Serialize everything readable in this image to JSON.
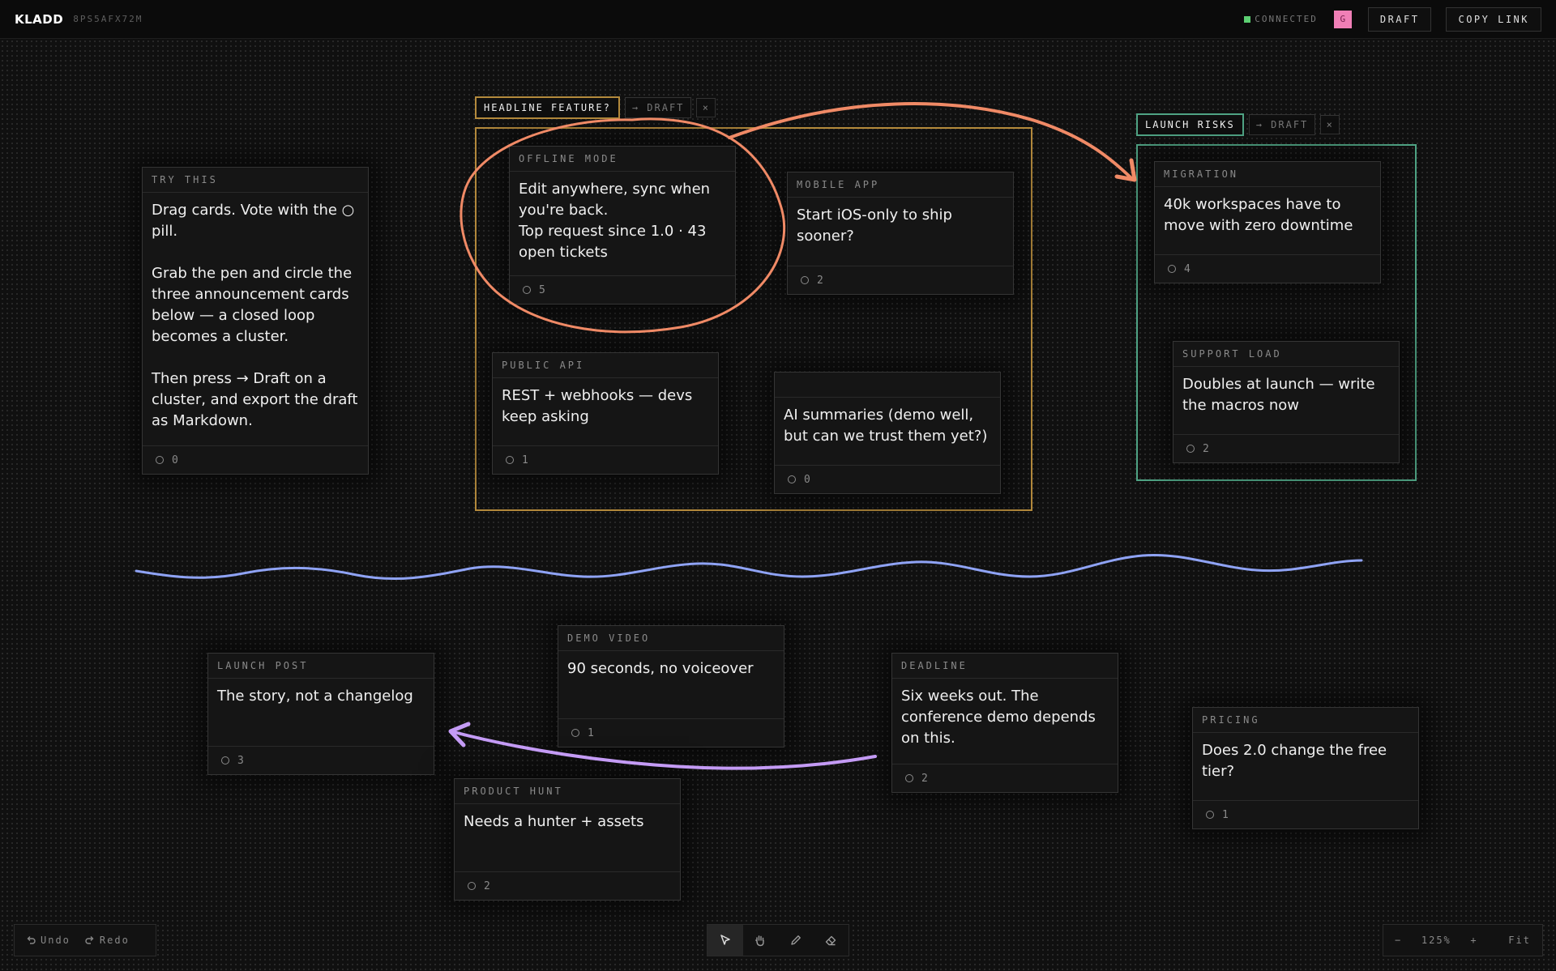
{
  "app": {
    "name": "KLADD",
    "board_id": "8PS5AFX72M"
  },
  "topbar": {
    "status": "CONNECTED",
    "avatar": "G",
    "draft_label": "DRAFT",
    "copy_link_label": "COPY LINK"
  },
  "clusters": [
    {
      "label": "HEADLINE FEATURE?",
      "draft_label": "→ DRAFT",
      "close_label": "×",
      "color": "#b48a3c"
    },
    {
      "label": "LAUNCH RISKS",
      "draft_label": "→ DRAFT",
      "close_label": "×",
      "color": "#4fa384"
    }
  ],
  "cards": {
    "try_this": {
      "title": "TRY THIS",
      "body": "Drag cards. Vote with the ○ pill.\n\nGrab the pen and circle the three announcement cards below — a closed loop becomes a cluster.\n\nThen press → Draft on a cluster, and export the draft as Markdown.",
      "votes": "0"
    },
    "offline_mode": {
      "title": "OFFLINE MODE",
      "body": "Edit anywhere, sync when you're back.\nTop request since 1.0 · 43 open tickets",
      "votes": "5"
    },
    "mobile_app": {
      "title": "MOBILE APP",
      "body": "Start iOS-only to ship sooner?",
      "votes": "2"
    },
    "public_api": {
      "title": "PUBLIC API",
      "body": "REST + webhooks — devs keep asking",
      "votes": "1"
    },
    "ai_summaries": {
      "title": "",
      "body": "AI summaries (demo well, but can we trust them yet?)",
      "votes": "0"
    },
    "migration": {
      "title": "MIGRATION",
      "body": "40k workspaces have to move with zero downtime",
      "votes": "4"
    },
    "support_load": {
      "title": "SUPPORT LOAD",
      "body": "Doubles at launch — write the macros now",
      "votes": "2"
    },
    "launch_post": {
      "title": "LAUNCH POST",
      "body": "The story, not a changelog",
      "votes": "3"
    },
    "demo_video": {
      "title": "DEMO VIDEO",
      "body": "90 seconds, no voiceover",
      "votes": "1"
    },
    "deadline": {
      "title": "DEADLINE",
      "body": "Six weeks out. The conference demo depends on this.",
      "votes": "2"
    },
    "product_hunt": {
      "title": "PRODUCT HUNT",
      "body": "Needs a hunter + assets",
      "votes": "2"
    },
    "pricing": {
      "title": "PRICING",
      "body": "Does 2.0 change the free tier?",
      "votes": "1"
    }
  },
  "history": {
    "undo": "Undo",
    "redo": "Redo"
  },
  "tools": [
    {
      "name": "select",
      "icon": "cursor-arrow-icon",
      "active": true
    },
    {
      "name": "hand",
      "icon": "hand-icon",
      "active": false
    },
    {
      "name": "pen",
      "icon": "pen-icon",
      "active": false
    },
    {
      "name": "eraser",
      "icon": "eraser-icon",
      "active": false
    }
  ],
  "zoom": {
    "minus": "−",
    "level": "125%",
    "plus": "+",
    "fit": "Fit"
  },
  "colors": {
    "annotation_orange": "#f08a66",
    "annotation_blue": "#8fa3f5",
    "annotation_purple": "#c49bf5",
    "accent_green": "#5ccf72",
    "avatar_pink": "#f07fb6"
  }
}
